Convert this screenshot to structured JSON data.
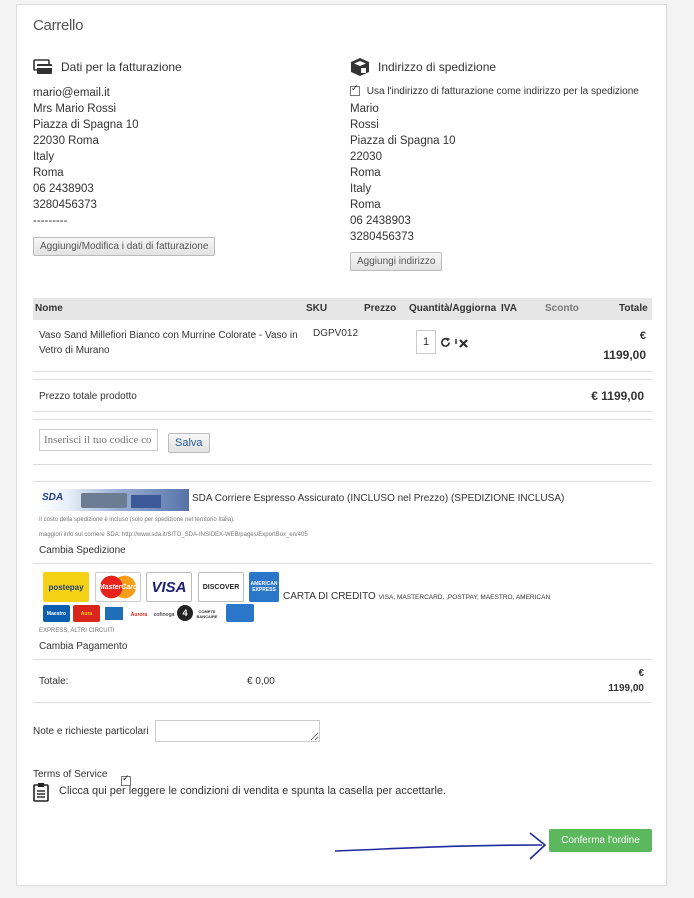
{
  "page_title": "Carrello",
  "billing": {
    "heading": "Dati per la fatturazione",
    "lines": [
      "mario@email.it",
      "Mrs Mario Rossi",
      "Piazza di Spagna 10",
      "22030 Roma",
      "Italy",
      "Roma",
      "06 2438903",
      "3280456373",
      "---------"
    ],
    "button": "Aggiungi/Modifica i dati di fatturazione"
  },
  "shipping": {
    "heading": "Indirizzo di spedizione",
    "same_address_label": "Usa l'indirizzo di fatturazione come indirizzo per la spedizione",
    "same_address_checked": true,
    "lines": [
      "Mario",
      "Rossi",
      "Piazza di Spagna 10",
      "22030",
      "Roma",
      "Italy",
      "Roma",
      "06 2438903",
      "3280456373"
    ],
    "button": "Aggiungi indirizzo"
  },
  "table": {
    "headers": {
      "name": "Nome",
      "sku": "SKU",
      "price": "Prezzo",
      "qty": "Quantità/Aggiorna",
      "vat": "IVA",
      "discount": "Sconto",
      "total": "Totale"
    },
    "rows": [
      {
        "name": "Vaso Sand Millefiori Bianco con Murrine Colorate - Vaso in Vetro di Murano",
        "sku": "DGPV012",
        "qty": "1",
        "currency": "€",
        "total": "1199,00"
      }
    ]
  },
  "product_total": {
    "label": "Prezzo totale prodotto",
    "value": "€ 1199,00"
  },
  "coupon": {
    "placeholder": "Inserisci il tuo codice co",
    "button": "Salva"
  },
  "shipping_method": {
    "logo_text": "SDA",
    "title": "SDA Corriere Espresso Assicurato (INCLUSO nel Prezzo) (SPEDIZIONE INCLUSA)",
    "note1": "Il costo della spedizione è incluso (solo per spedizione nel territorio Italia).",
    "note2": "maggiori info sul corriere SDA: http://www.sda.it/SITO_SDA-INSIDEX-WEB/pages/ExportBox_en/405",
    "change": "Cambia Spedizione"
  },
  "payment": {
    "logos": {
      "postepay": "postepay",
      "mastercard": "MasterCard",
      "visa": "VISA",
      "discover": "DISCOVER",
      "amex": "AMERICAN EXPRESS",
      "maestro": "Maestro",
      "aura": "Aura",
      "aurora": "Aurora",
      "cofinoga": "cofinoga",
      "four": "4",
      "cb": "COMPTE BANCAIRE"
    },
    "title": "CARTA DI CREDITO",
    "title_small": "VISA, MASTERCARD, ,POSTPAY, MAESTRO, AMERICAN",
    "title_small2": "EXPRESS, ALTRI CIRCUITI",
    "change": "Cambia Pagamento"
  },
  "totals": {
    "label": "Totale:",
    "amount": "€ 0,00",
    "currency": "€",
    "value": "1199,00"
  },
  "notes": {
    "label": "Note e richieste particolari"
  },
  "terms": {
    "label": "Terms of Service",
    "checked": true,
    "text": "Clicca qui per leggere le condizioni di vendita e spunta la casella per accettarle."
  },
  "confirm_button": "Conferma l'ordine",
  "colors": {
    "confirm": "#5cb85c",
    "arrow": "#1f2aa0",
    "header_bg": "#e6e6e6"
  }
}
